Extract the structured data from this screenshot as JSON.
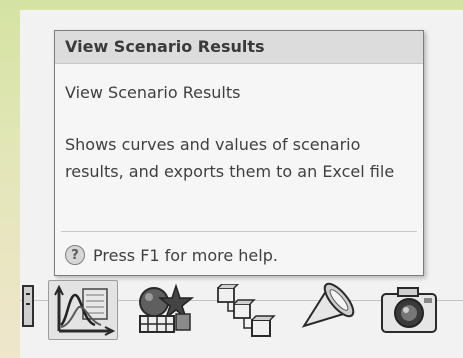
{
  "tooltip": {
    "title": "View Scenario Results",
    "subtitle": "View Scenario Results",
    "description": "Shows curves and values of scenario results, and exports them to an Excel file",
    "help_text": "Press F1 for more help.",
    "help_icon": "question-icon"
  },
  "toolbar": {
    "buttons": [
      {
        "icon": "partial-tool-icon"
      },
      {
        "icon": "view-scenario-results-icon",
        "selected": true
      },
      {
        "icon": "shape-star-grid-icon"
      },
      {
        "icon": "connected-cubes-icon"
      },
      {
        "icon": "cone-light-icon"
      },
      {
        "icon": "camera-icon"
      }
    ]
  },
  "colors": {
    "background_top": "#d4e3a2",
    "tooltip_header": "#dcdcdc",
    "tooltip_body": "#f6f6f6"
  }
}
